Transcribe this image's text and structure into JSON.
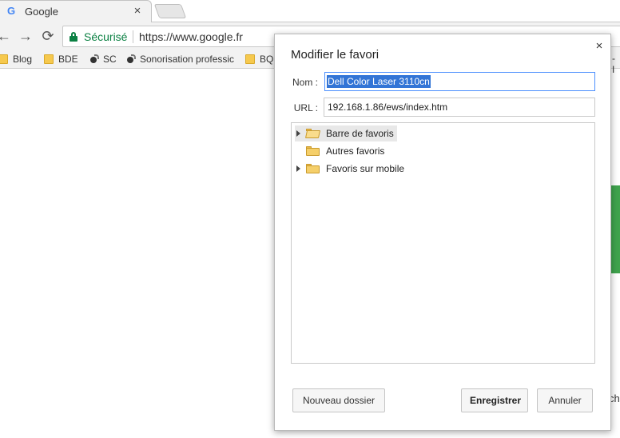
{
  "browser": {
    "tab": {
      "favicon": "G",
      "title": "Google",
      "close": "×"
    },
    "nav": {
      "back": "←",
      "forward": "→",
      "reload": "⟳"
    },
    "omnibox": {
      "secure_label": "Sécurisé",
      "url": "https://www.google.fr"
    },
    "bookmarks": [
      {
        "label": "Blog",
        "icon": "folder-icon"
      },
      {
        "label": "BDE",
        "icon": "folder-icon"
      },
      {
        "label": "SC",
        "icon": "sound-icon"
      },
      {
        "label": "Sonorisation professic",
        "icon": "sound-icon"
      },
      {
        "label": "BQ",
        "icon": "folder-icon"
      }
    ],
    "bookmarks_right_fragment": "- I",
    "page_right_fragment": "ch"
  },
  "dialog": {
    "title": "Modifier le favori",
    "close": "×",
    "name_label": "Nom :",
    "name_value": "Dell Color Laser 3110cn",
    "url_label": "URL :",
    "url_value": "192.168.1.86/ews/index.htm",
    "folders": [
      {
        "label": "Barre de favoris",
        "expandable": true,
        "selected": true
      },
      {
        "label": "Autres favoris",
        "expandable": false,
        "selected": false
      },
      {
        "label": "Favoris sur mobile",
        "expandable": true,
        "selected": false
      }
    ],
    "buttons": {
      "new_folder": "Nouveau dossier",
      "save": "Enregistrer",
      "cancel": "Annuler"
    }
  },
  "colors": {
    "secure_green": "#0b8043",
    "selection_blue": "#3375d6",
    "focus_blue": "#4d90fe",
    "folder_yellow": "#f5cf6a"
  }
}
